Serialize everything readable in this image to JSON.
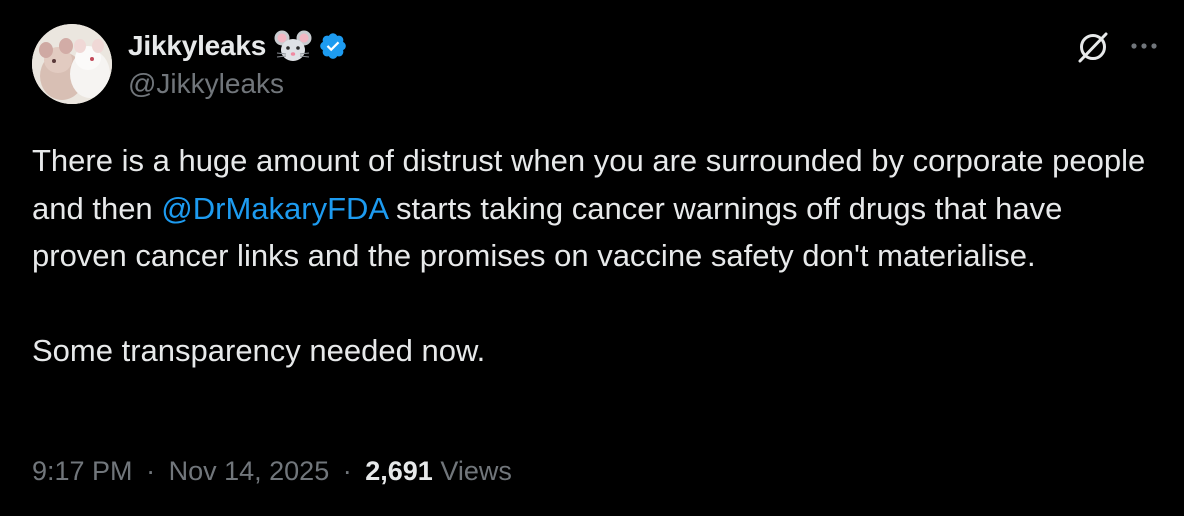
{
  "author": {
    "display_name": "Jikkyleaks",
    "handle": "@Jikkyleaks",
    "name_emoji": "mouse-face-emoji",
    "verified_badge": "verified-badge-icon"
  },
  "header_actions": {
    "grok_icon": "grok-icon",
    "more_icon": "more-options-icon"
  },
  "tweet": {
    "text_part1": "There is a huge amount of distrust when you are surrounded by corporate people and then ",
    "mention": "@DrMakaryFDA",
    "text_part2": " starts taking cancer warnings off drugs that have proven cancer links and the promises on vaccine safety don't materialise.",
    "text_para2": "Some transparency needed now."
  },
  "meta": {
    "time": "9:17 PM",
    "date": "Nov 14, 2025",
    "separator": "·",
    "views_count": "2,691",
    "views_label": "Views"
  },
  "colors": {
    "background": "#000000",
    "text_primary": "#e7e9ea",
    "text_secondary": "#71767b",
    "accent": "#1d9bf0"
  }
}
